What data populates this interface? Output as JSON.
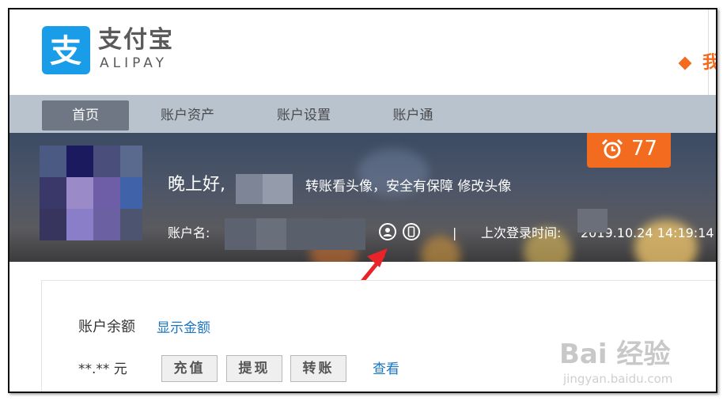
{
  "logo": {
    "cn": "支付宝",
    "en": "ALIPAY"
  },
  "header": {
    "corner_text": "我"
  },
  "nav": {
    "items": [
      {
        "label": "首页",
        "active": true
      },
      {
        "label": "账户资产",
        "active": false
      },
      {
        "label": "账户设置",
        "active": false
      },
      {
        "label": "账户通",
        "active": false
      }
    ]
  },
  "banner": {
    "greeting": "晚上好,",
    "greeting_note": "转账看头像，安全有保障 修改头像",
    "account_label": "账户名:",
    "separator": "|",
    "last_login_label": "上次登录时间:",
    "last_login_time": "2019.10.24 14:19:14",
    "badge_count": "77"
  },
  "balance": {
    "label": "账户余额",
    "show_link": "显示金额",
    "amount": "**.** 元",
    "buttons": [
      "充值",
      "提现",
      "转账"
    ],
    "view_link": "查看"
  },
  "watermark": {
    "main": "Bai 经验",
    "sub": "jingyan.baidu.com"
  },
  "colors": {
    "brand_blue": "#1a9de8",
    "accent_orange": "#f26b1f",
    "link_blue": "#1a75c4",
    "nav_bg": "#b9c3ce",
    "nav_active": "#6e7783"
  }
}
